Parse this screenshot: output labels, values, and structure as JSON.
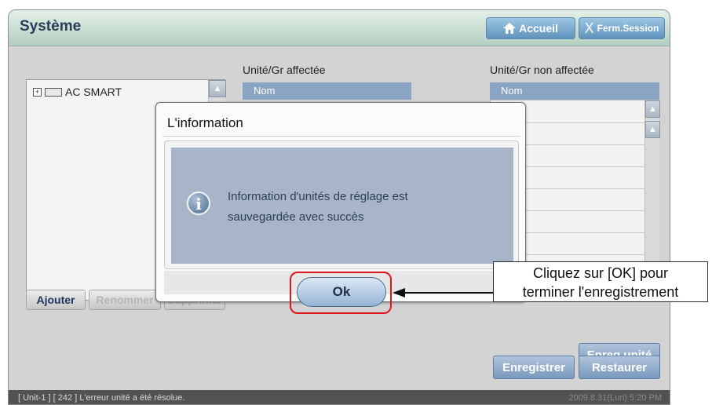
{
  "header": {
    "title": "Système",
    "home_label": "Accueil",
    "close_session_label": "Ferm.Session",
    "close_session_glyph": "X"
  },
  "tree": {
    "root_label": "AC SMART"
  },
  "assigned": {
    "label": "Unité/Gr affectée",
    "column_name": "Nom"
  },
  "unassigned": {
    "label": "Unité/Gr non affectée",
    "column_name": "Nom"
  },
  "buttons": {
    "add": "Ajouter",
    "rename": "Renommer",
    "delete": "Supprimer",
    "save_unit": "Enreg.unité",
    "save": "Enregistrer",
    "restore": "Restaurer"
  },
  "status": {
    "message": "[ Unit-1 ] [ 242 ] L'erreur unité a été résolue.",
    "datetime": "2009.8.31(Lun) 5:20 PM"
  },
  "dialog": {
    "title": "L'information",
    "message_line1": "Information d'unités de réglage est",
    "message_line2": "sauvegardée avec succès",
    "ok_label": "Ok",
    "icon": "info-icon"
  },
  "annotation": {
    "line1": "Cliquez sur [OK] pour",
    "line2": "terminer l'enregistrement"
  },
  "colors": {
    "highlight": "#e0151e",
    "header_blue": "#8aa5c4"
  }
}
